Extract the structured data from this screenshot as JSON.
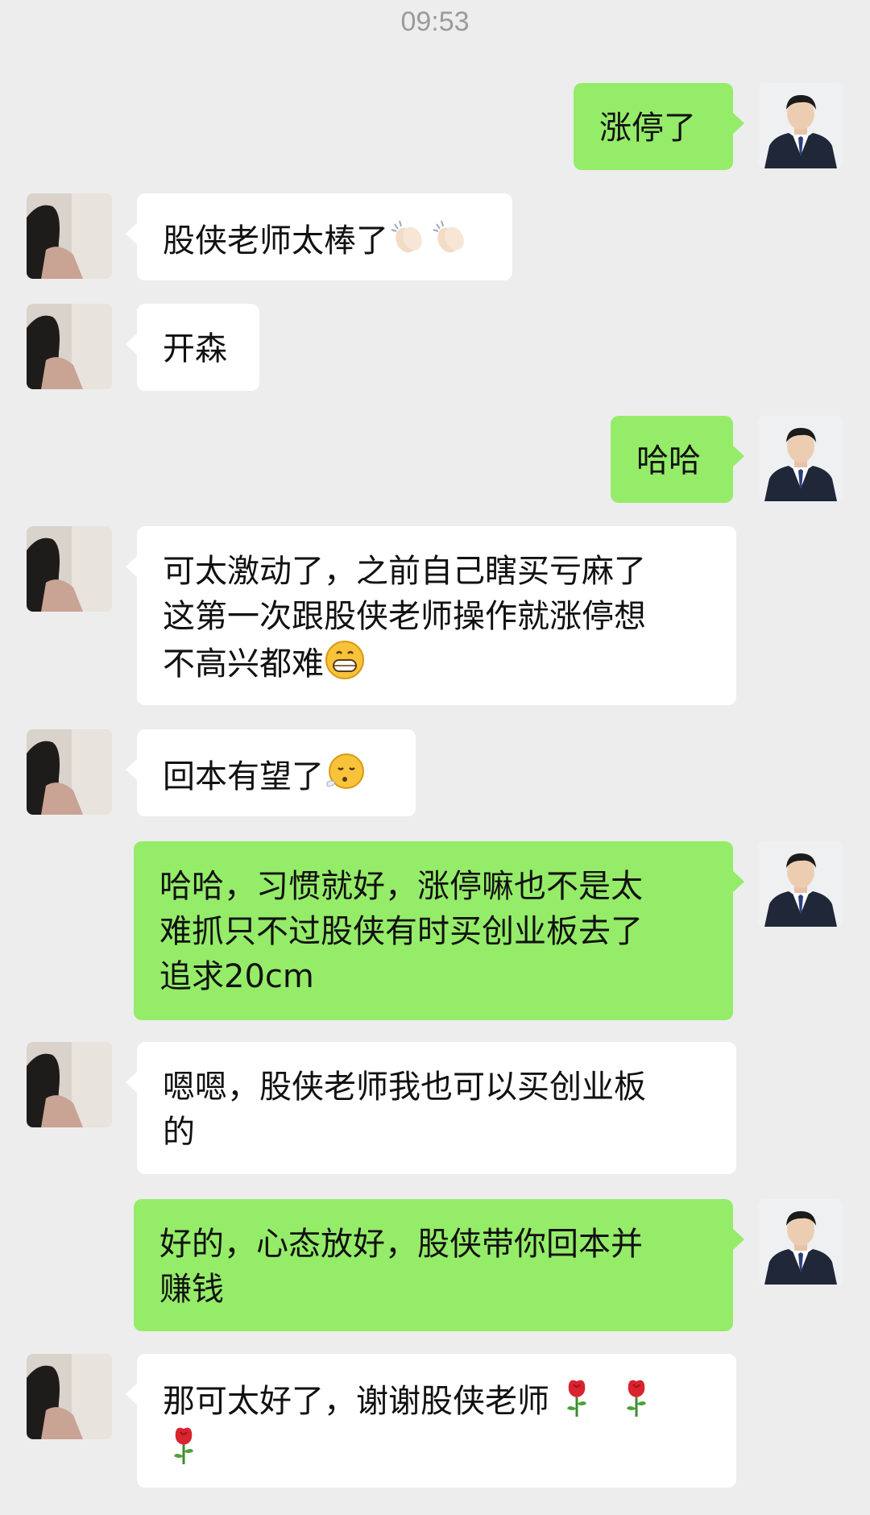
{
  "status_time": "09:53",
  "colors": {
    "background": "#ededed",
    "bubble_sent": "#95ec69",
    "bubble_received": "#ffffff",
    "time_text": "#9b9b9b"
  },
  "messages": [
    {
      "side": "right",
      "sender": "teacher",
      "text": "涨停了",
      "emojis": []
    },
    {
      "side": "left",
      "sender": "student",
      "text": "股侠老师太棒了",
      "emojis": [
        "clapping-hands",
        "clapping-hands"
      ]
    },
    {
      "side": "left",
      "sender": "student",
      "text": "开森",
      "emojis": []
    },
    {
      "side": "right",
      "sender": "teacher",
      "text": "哈哈",
      "emojis": []
    },
    {
      "side": "left",
      "sender": "student",
      "text": "可太激动了，之前自己瞎买亏麻了\n这第一次跟股侠老师操作就涨停想\n不高兴都难",
      "emojis": [
        "grinning-face"
      ]
    },
    {
      "side": "left",
      "sender": "student",
      "text": "回本有望了",
      "emojis": [
        "exhaling-face"
      ]
    },
    {
      "side": "right",
      "sender": "teacher",
      "text": "哈哈，习惯就好，涨停嘛也不是太\n难抓只不过股侠有时买创业板去了\n追求20cm",
      "emojis": []
    },
    {
      "side": "left",
      "sender": "student",
      "text": "嗯嗯，股侠老师我也可以买创业板\n的",
      "emojis": []
    },
    {
      "side": "right",
      "sender": "teacher",
      "text": "好的，心态放好，股侠带你回本并\n赚钱",
      "emojis": []
    },
    {
      "side": "left",
      "sender": "student",
      "text": "那可太好了，谢谢股侠老师",
      "emojis": [
        "rose",
        "rose",
        "rose"
      ]
    }
  ]
}
